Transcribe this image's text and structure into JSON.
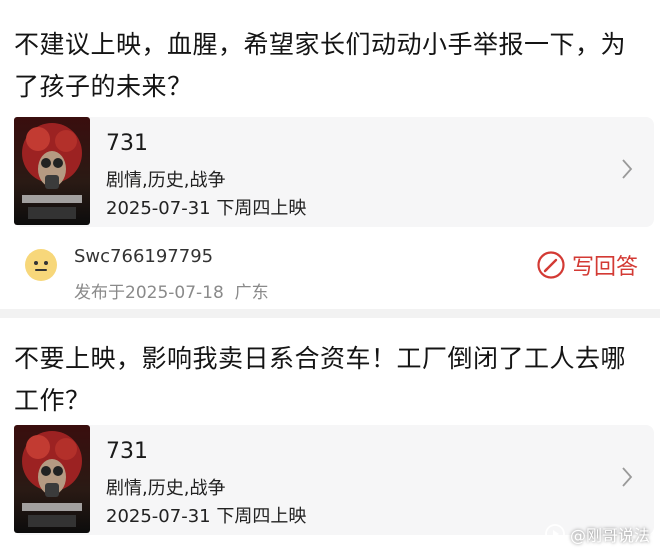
{
  "posts": [
    {
      "question": "不建议上映，血腥，希望家长们动动小手举报一下，为了孩子的未来？",
      "movie": {
        "title": "731",
        "genre": "剧情,历史,战争",
        "release": "2025-07-31 下周四上映",
        "poster_icon": "movie-poster-image"
      },
      "user": {
        "name": "Swc766197795",
        "published": "发布于2025-07-18",
        "location": "广东",
        "avatar_icon": "avatar-face-icon"
      },
      "answer_label": "写回答"
    },
    {
      "question": "不要上映，影响我卖日系合资车！工厂倒闭了工人去哪工作？",
      "movie": {
        "title": "731",
        "genre": "剧情,历史,战争",
        "release": "2025-07-31 下周四上映",
        "poster_icon": "movie-poster-image"
      }
    }
  ],
  "watermark": {
    "text": "@刚哥说法",
    "icon": "watermark-logo-icon"
  },
  "colors": {
    "accent": "#d33a34",
    "background": "#f2f2f2",
    "card": "#ffffff",
    "movie_card": "#f6f6f7",
    "muted_text": "#8a8a8a"
  }
}
